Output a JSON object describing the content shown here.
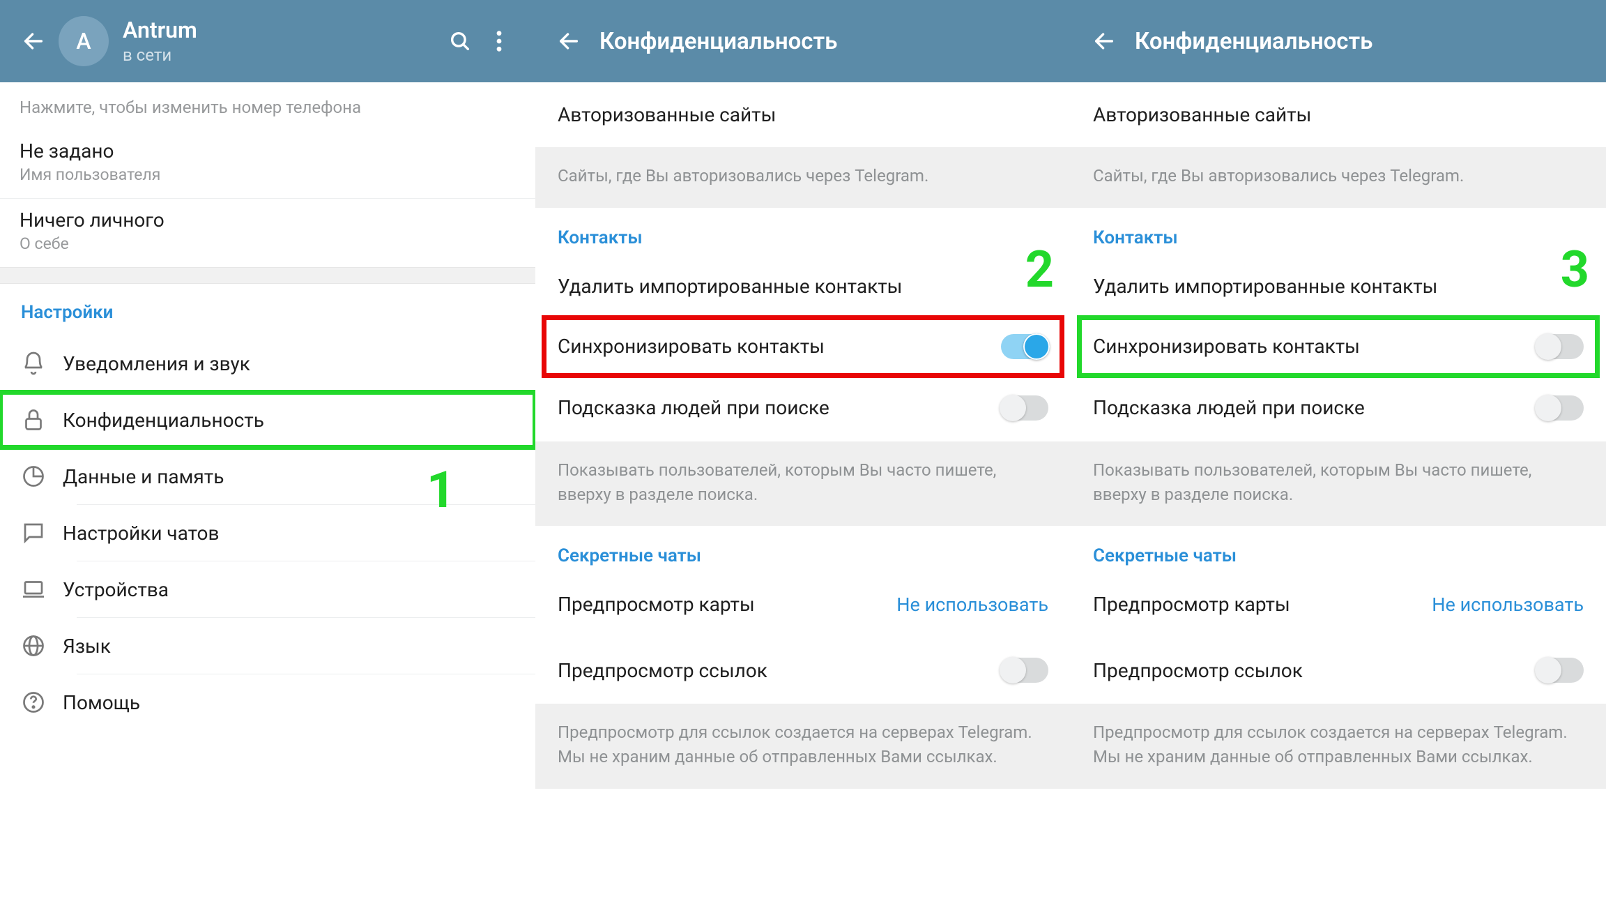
{
  "panel1": {
    "profile_name": "Antrum",
    "profile_status": "в сети",
    "avatar_initial": "A",
    "hint": "Нажмите, чтобы изменить номер телефона",
    "username_val": "Не задано",
    "username_lbl": "Имя пользователя",
    "bio_val": "Ничего личного",
    "bio_lbl": "О себе",
    "section_title": "Настройки",
    "items": {
      "notifications": "Уведомления и звук",
      "privacy": "Конфиденциальность",
      "data": "Данные и память",
      "chats": "Настройки чатов",
      "devices": "Устройства",
      "language": "Язык",
      "help": "Помощь"
    },
    "annotation_number": "1"
  },
  "panel2": {
    "title": "Конфиденциальность",
    "auth_sites": "Авторизованные сайты",
    "auth_sites_hint": "Сайты, где Вы авторизовались через Telegram.",
    "contacts_header": "Контакты",
    "delete_contacts": "Удалить импортированные контакты",
    "sync_contacts": "Синхронизировать контакты",
    "suggest_people": "Подсказка людей при поиске",
    "suggest_hint": "Показывать пользователей, которым Вы часто пишете, вверху в разделе поиска.",
    "secret_chats_header": "Секретные чаты",
    "map_preview": "Предпросмотр карты",
    "map_preview_value": "Не использовать",
    "link_preview": "Предпросмотр ссылок",
    "link_hint": "Предпросмотр для ссылок создается на серверах Telegram. Мы не храним данные об отправленных Вами ссылках.",
    "annotation_number": "2",
    "sync_on": true,
    "suggest_on": false,
    "link_on": false
  },
  "panel3": {
    "title": "Конфиденциальность",
    "auth_sites": "Авторизованные сайты",
    "auth_sites_hint": "Сайты, где Вы авторизовались через Telegram.",
    "contacts_header": "Контакты",
    "delete_contacts": "Удалить импортированные контакты",
    "sync_contacts": "Синхронизировать контакты",
    "suggest_people": "Подсказка людей при поиске",
    "suggest_hint": "Показывать пользователей, которым Вы часто пишете, вверху в разделе поиска.",
    "secret_chats_header": "Секретные чаты",
    "map_preview": "Предпросмотр карты",
    "map_preview_value": "Не использовать",
    "link_preview": "Предпросмотр ссылок",
    "link_hint": "Предпросмотр для ссылок создается на серверах Telegram. Мы не храним данные об отправленных Вами ссылках.",
    "annotation_number": "3",
    "sync_on": false,
    "suggest_on": false,
    "link_on": false
  }
}
